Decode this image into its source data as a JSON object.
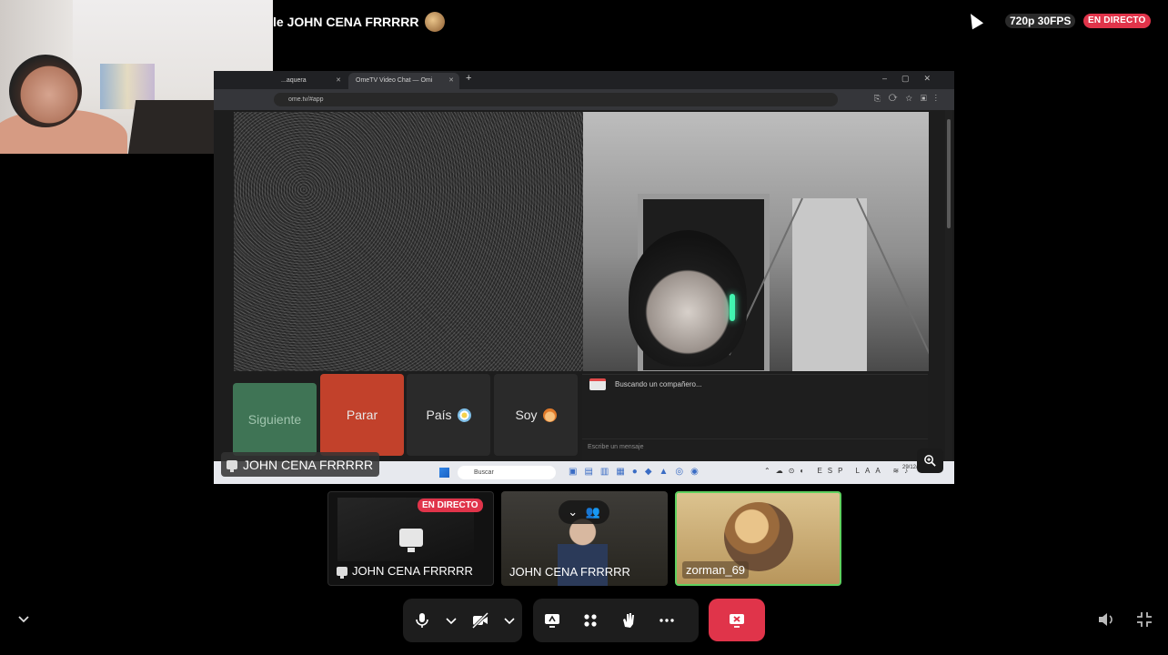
{
  "header": {
    "title": "le JOHN CENA FRRRRR",
    "quality": "720p 30FPS",
    "live_badge": "EN DIRECTO"
  },
  "browser": {
    "tabs": [
      {
        "label": "...aquera"
      },
      {
        "label": "OmeTV Video Chat — Omi"
      }
    ],
    "url": "ome.tv/#app"
  },
  "ometv": {
    "buttons": {
      "next": "Siguiente",
      "stop": "Parar",
      "country": "País",
      "gender": "Soy"
    },
    "chat_status": "Buscando un compañero...",
    "chat_placeholder": "Escribe un mensaje"
  },
  "taskbar": {
    "search": "Buscar",
    "tray_lang": "ESP LAA",
    "date": "29/12/2025"
  },
  "share_label": "JOHN CENA FRRRRR",
  "participants": [
    {
      "name": "JOHN CENA FRRRRR",
      "badge": "EN DIRECTO",
      "type": "screen"
    },
    {
      "name": "JOHN CENA FRRRRR",
      "type": "camera"
    },
    {
      "name": "zorman_69",
      "type": "avatar",
      "speaking": true
    }
  ],
  "icons": {
    "mic": "microphone-icon",
    "camera_off": "camera-off-icon",
    "share": "screen-share-icon",
    "apps": "apps-icon",
    "reactions": "hand-icon",
    "more": "more-icon",
    "leave": "leave-icon",
    "volume": "volume-icon",
    "fullscreen": "exit-fullscreen-icon"
  },
  "colors": {
    "live": "#e0344a",
    "speaking_border": "#5fd05f",
    "siguiente": "#3f7455",
    "parar": "#c2412b"
  }
}
